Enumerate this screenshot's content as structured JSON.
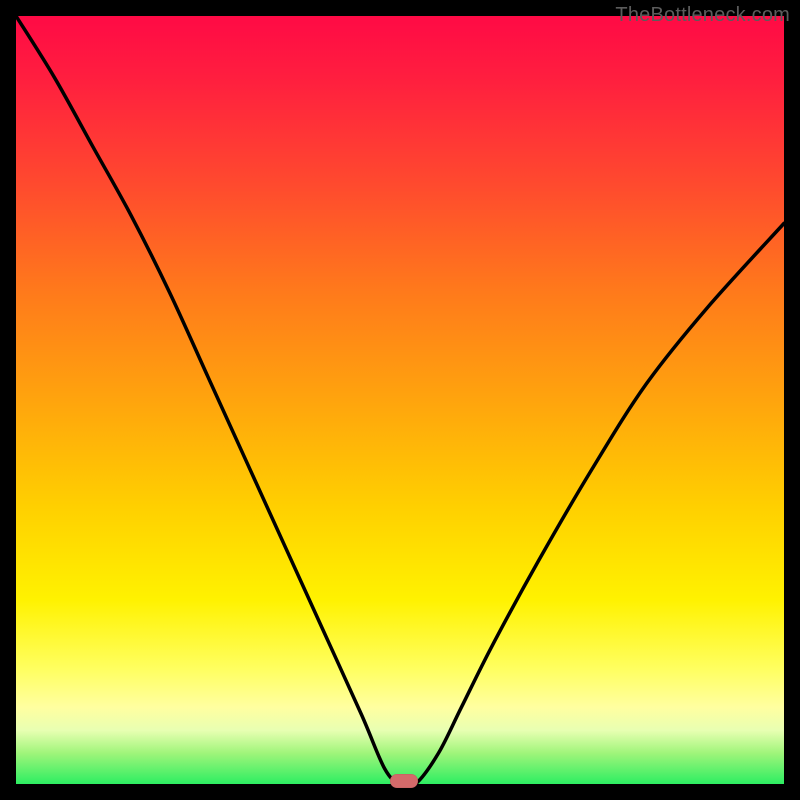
{
  "watermark": "TheBottleneck.com",
  "colors": {
    "page_bg": "#000000",
    "gradient_top": "#ff0a45",
    "gradient_mid": "#ffd000",
    "gradient_bottom": "#2dee62",
    "curve": "#000000",
    "marker": "#d46a6a",
    "watermark_text": "#5c5c5c"
  },
  "chart_data": {
    "type": "line",
    "title": "",
    "xlabel": "",
    "ylabel": "",
    "xlim": [
      0,
      100
    ],
    "ylim": [
      0,
      100
    ],
    "grid": false,
    "legend_position": "none",
    "series": [
      {
        "name": "bottleneck-curve",
        "x": [
          0,
          5,
          10,
          15,
          20,
          25,
          30,
          35,
          40,
          45,
          48,
          50,
          52,
          55,
          58,
          62,
          68,
          75,
          82,
          90,
          100
        ],
        "values": [
          100,
          92,
          83,
          74,
          64,
          53,
          42,
          31,
          20,
          9,
          2,
          0,
          0,
          4,
          10,
          18,
          29,
          41,
          52,
          62,
          73
        ]
      }
    ],
    "annotations": [
      {
        "name": "min-marker",
        "x": 50.5,
        "y": 0,
        "shape": "pill",
        "color": "#d46a6a"
      }
    ],
    "background_gradient": {
      "direction": "vertical",
      "stops": [
        {
          "pos": 0.0,
          "color": "#ff0a45"
        },
        {
          "pos": 0.5,
          "color": "#ffa40d"
        },
        {
          "pos": 0.76,
          "color": "#fff200"
        },
        {
          "pos": 0.93,
          "color": "#e8ffb2"
        },
        {
          "pos": 1.0,
          "color": "#2dee62"
        }
      ]
    }
  }
}
